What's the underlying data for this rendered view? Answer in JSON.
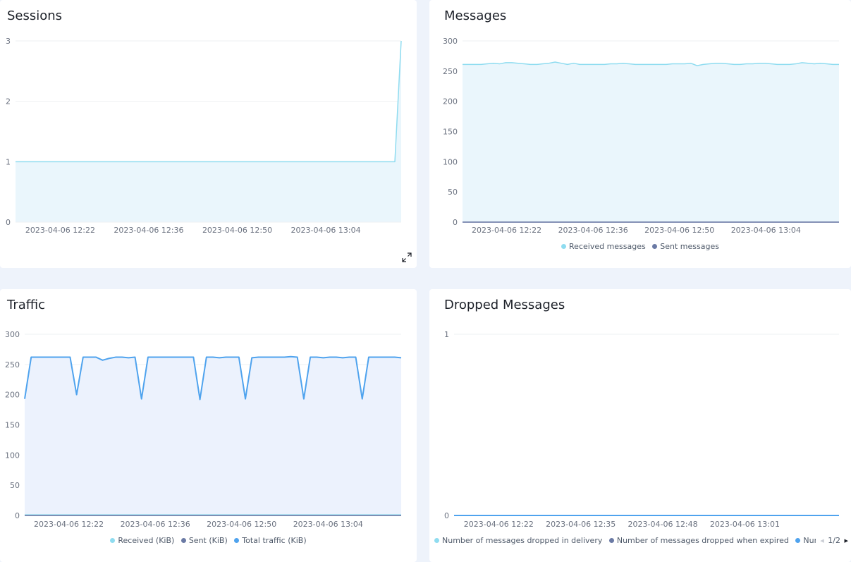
{
  "colors": {
    "received": "#8fdcf0",
    "sent": "#6b7aa5",
    "total": "#4fa3ee",
    "grid": "#eef0f3",
    "axis": "#6b7aa5"
  },
  "chart_data": [
    {
      "type": "area",
      "title": "Sessions",
      "x": [
        "2023-04-06 12:18",
        "2023-04-06 12:19",
        "2023-04-06 12:20",
        "2023-04-06 12:21",
        "2023-04-06 12:22",
        "2023-04-06 12:23",
        "2023-04-06 12:24",
        "2023-04-06 12:25",
        "2023-04-06 12:26",
        "2023-04-06 12:27",
        "2023-04-06 12:28",
        "2023-04-06 12:29",
        "2023-04-06 12:30",
        "2023-04-06 12:31",
        "2023-04-06 12:32",
        "2023-04-06 12:33",
        "2023-04-06 12:34",
        "2023-04-06 12:35",
        "2023-04-06 12:36",
        "2023-04-06 12:37",
        "2023-04-06 12:38",
        "2023-04-06 12:39",
        "2023-04-06 12:40",
        "2023-04-06 12:41",
        "2023-04-06 12:42",
        "2023-04-06 12:43",
        "2023-04-06 12:44",
        "2023-04-06 12:45",
        "2023-04-06 12:46",
        "2023-04-06 12:47",
        "2023-04-06 12:48",
        "2023-04-06 12:49",
        "2023-04-06 12:50",
        "2023-04-06 12:51",
        "2023-04-06 12:52",
        "2023-04-06 12:53",
        "2023-04-06 12:54",
        "2023-04-06 12:55",
        "2023-04-06 12:56",
        "2023-04-06 12:57",
        "2023-04-06 12:58",
        "2023-04-06 12:59",
        "2023-04-06 13:00",
        "2023-04-06 13:01",
        "2023-04-06 13:02",
        "2023-04-06 13:03",
        "2023-04-06 13:04",
        "2023-04-06 13:05",
        "2023-04-06 13:06",
        "2023-04-06 13:07",
        "2023-04-06 13:08",
        "2023-04-06 13:09",
        "2023-04-06 13:10",
        "2023-04-06 13:11",
        "2023-04-06 13:12",
        "2023-04-06 13:13",
        "2023-04-06 13:14",
        "2023-04-06 13:15",
        "2023-04-06 13:16",
        "2023-04-06 13:17",
        "2023-04-06 13:18",
        "2023-04-06 13:19"
      ],
      "xticks": [
        "2023-04-06 12:22",
        "2023-04-06 12:36",
        "2023-04-06 12:50",
        "2023-04-06 13:04"
      ],
      "ylim": [
        0,
        3
      ],
      "yticks": [
        0,
        1,
        2,
        3
      ],
      "grid": true,
      "legend": "none",
      "series": [
        {
          "color_key": "received",
          "values": [
            1,
            1,
            1,
            1,
            1,
            1,
            1,
            1,
            1,
            1,
            1,
            1,
            1,
            1,
            1,
            1,
            1,
            1,
            1,
            1,
            1,
            1,
            1,
            1,
            1,
            1,
            1,
            1,
            1,
            1,
            1,
            1,
            1,
            1,
            1,
            1,
            1,
            1,
            1,
            1,
            1,
            1,
            1,
            1,
            1,
            1,
            1,
            1,
            1,
            1,
            1,
            1,
            1,
            1,
            1,
            1,
            1,
            1,
            1,
            1,
            1,
            3
          ]
        }
      ]
    },
    {
      "type": "area",
      "title": "Messages",
      "x": [
        "2023-04-06 12:18",
        "2023-04-06 12:19",
        "2023-04-06 12:20",
        "2023-04-06 12:21",
        "2023-04-06 12:22",
        "2023-04-06 12:23",
        "2023-04-06 12:24",
        "2023-04-06 12:25",
        "2023-04-06 12:26",
        "2023-04-06 12:27",
        "2023-04-06 12:28",
        "2023-04-06 12:29",
        "2023-04-06 12:30",
        "2023-04-06 12:31",
        "2023-04-06 12:32",
        "2023-04-06 12:33",
        "2023-04-06 12:34",
        "2023-04-06 12:35",
        "2023-04-06 12:36",
        "2023-04-06 12:37",
        "2023-04-06 12:38",
        "2023-04-06 12:39",
        "2023-04-06 12:40",
        "2023-04-06 12:41",
        "2023-04-06 12:42",
        "2023-04-06 12:43",
        "2023-04-06 12:44",
        "2023-04-06 12:45",
        "2023-04-06 12:46",
        "2023-04-06 12:47",
        "2023-04-06 12:48",
        "2023-04-06 12:49",
        "2023-04-06 12:50",
        "2023-04-06 12:51",
        "2023-04-06 12:52",
        "2023-04-06 12:53",
        "2023-04-06 12:54",
        "2023-04-06 12:55",
        "2023-04-06 12:56",
        "2023-04-06 12:57",
        "2023-04-06 12:58",
        "2023-04-06 12:59",
        "2023-04-06 13:00",
        "2023-04-06 13:01",
        "2023-04-06 13:02",
        "2023-04-06 13:03",
        "2023-04-06 13:04",
        "2023-04-06 13:05",
        "2023-04-06 13:06",
        "2023-04-06 13:07",
        "2023-04-06 13:08",
        "2023-04-06 13:09",
        "2023-04-06 13:10",
        "2023-04-06 13:11",
        "2023-04-06 13:12",
        "2023-04-06 13:13",
        "2023-04-06 13:14",
        "2023-04-06 13:15",
        "2023-04-06 13:16",
        "2023-04-06 13:17",
        "2023-04-06 13:18",
        "2023-04-06 13:19"
      ],
      "xticks": [
        "2023-04-06 12:22",
        "2023-04-06 12:36",
        "2023-04-06 12:50",
        "2023-04-06 13:04"
      ],
      "ylim": [
        0,
        300
      ],
      "yticks": [
        0,
        50,
        100,
        150,
        200,
        250,
        300
      ],
      "grid": true,
      "legend": "bottom",
      "series": [
        {
          "name": "Received messages",
          "color_key": "received",
          "values": [
            261,
            261,
            261,
            261,
            262,
            263,
            262,
            264,
            264,
            263,
            262,
            261,
            261,
            262,
            263,
            265,
            263,
            261,
            263,
            261,
            261,
            261,
            261,
            261,
            262,
            262,
            263,
            262,
            261,
            261,
            261,
            261,
            261,
            261,
            262,
            262,
            262,
            263,
            259,
            261,
            262,
            263,
            263,
            262,
            261,
            261,
            262,
            262,
            263,
            263,
            262,
            261,
            261,
            261,
            262,
            264,
            263,
            262,
            263,
            262,
            261,
            261
          ]
        },
        {
          "name": "Sent messages",
          "color_key": "sent",
          "values": [
            0,
            0,
            0,
            0,
            0,
            0,
            0,
            0,
            0,
            0,
            0,
            0,
            0,
            0,
            0,
            0,
            0,
            0,
            0,
            0,
            0,
            0,
            0,
            0,
            0,
            0,
            0,
            0,
            0,
            0,
            0,
            0,
            0,
            0,
            0,
            0,
            0,
            0,
            0,
            0,
            0,
            0,
            0,
            0,
            0,
            0,
            0,
            0,
            0,
            0,
            0,
            0,
            0,
            0,
            0,
            0,
            0,
            0,
            0,
            0,
            0,
            0
          ]
        }
      ]
    },
    {
      "type": "area",
      "title": "Traffic",
      "x": [
        "2023-04-06 12:18",
        "2023-04-06 12:19",
        "2023-04-06 12:20",
        "2023-04-06 12:21",
        "2023-04-06 12:22",
        "2023-04-06 12:23",
        "2023-04-06 12:24",
        "2023-04-06 12:25",
        "2023-04-06 12:26",
        "2023-04-06 12:27",
        "2023-04-06 12:28",
        "2023-04-06 12:29",
        "2023-04-06 12:30",
        "2023-04-06 12:31",
        "2023-04-06 12:32",
        "2023-04-06 12:33",
        "2023-04-06 12:34",
        "2023-04-06 12:35",
        "2023-04-06 12:36",
        "2023-04-06 12:37",
        "2023-04-06 12:38",
        "2023-04-06 12:39",
        "2023-04-06 12:40",
        "2023-04-06 12:41",
        "2023-04-06 12:42",
        "2023-04-06 12:43",
        "2023-04-06 12:44",
        "2023-04-06 12:45",
        "2023-04-06 12:46",
        "2023-04-06 12:47",
        "2023-04-06 12:48",
        "2023-04-06 12:49",
        "2023-04-06 12:50",
        "2023-04-06 12:51",
        "2023-04-06 12:52",
        "2023-04-06 12:53",
        "2023-04-06 12:54",
        "2023-04-06 12:55",
        "2023-04-06 12:56",
        "2023-04-06 12:57",
        "2023-04-06 12:58",
        "2023-04-06 12:59",
        "2023-04-06 13:00",
        "2023-04-06 13:01",
        "2023-04-06 13:02",
        "2023-04-06 13:03",
        "2023-04-06 13:04",
        "2023-04-06 13:05",
        "2023-04-06 13:06",
        "2023-04-06 13:07",
        "2023-04-06 13:08",
        "2023-04-06 13:09",
        "2023-04-06 13:10",
        "2023-04-06 13:11",
        "2023-04-06 13:12",
        "2023-04-06 13:13",
        "2023-04-06 13:14",
        "2023-04-06 13:15",
        "2023-04-06 13:16",
        "2023-04-06 13:17",
        "2023-04-06 13:18",
        "2023-04-06 13:19"
      ],
      "xticks": [
        "2023-04-06 12:22",
        "2023-04-06 12:36",
        "2023-04-06 12:50",
        "2023-04-06 13:04"
      ],
      "ylim": [
        0,
        300
      ],
      "yticks": [
        0,
        50,
        100,
        150,
        200,
        250,
        300
      ],
      "grid": true,
      "legend": "bottom",
      "series": [
        {
          "name": "Received (KiB)",
          "color_key": "received",
          "values": [
            1,
            1,
            1,
            1,
            1,
            1,
            1,
            1,
            1,
            1,
            1,
            1,
            1,
            1,
            1,
            1,
            1,
            1,
            1,
            1,
            1,
            1,
            1,
            1,
            1,
            1,
            1,
            1,
            1,
            1,
            1,
            1,
            1,
            1,
            1,
            1,
            1,
            1,
            1,
            1,
            1,
            1,
            1,
            1,
            1,
            1,
            1,
            1,
            1,
            1,
            1,
            1,
            1,
            1,
            1,
            1,
            1,
            1,
            1,
            1,
            1,
            1
          ]
        },
        {
          "name": "Sent (KiB)",
          "color_key": "sent",
          "values": [
            0,
            0,
            0,
            0,
            0,
            0,
            0,
            0,
            0,
            0,
            0,
            0,
            0,
            0,
            0,
            0,
            0,
            0,
            0,
            0,
            0,
            0,
            0,
            0,
            0,
            0,
            0,
            0,
            0,
            0,
            0,
            0,
            0,
            0,
            0,
            0,
            0,
            0,
            0,
            0,
            0,
            0,
            0,
            0,
            0,
            0,
            0,
            0,
            0,
            0,
            0,
            0,
            0,
            0,
            0,
            0,
            0,
            0,
            0,
            0,
            0,
            0
          ]
        },
        {
          "name": "Total traffic (KiB)",
          "color_key": "total",
          "values": [
            193,
            262,
            262,
            262,
            262,
            262,
            262,
            262,
            200,
            262,
            262,
            262,
            257,
            260,
            262,
            262,
            261,
            262,
            193,
            262,
            262,
            262,
            262,
            262,
            262,
            262,
            262,
            192,
            262,
            262,
            261,
            262,
            262,
            262,
            193,
            261,
            262,
            262,
            262,
            262,
            262,
            263,
            262,
            193,
            262,
            262,
            261,
            262,
            262,
            261,
            262,
            262,
            193,
            262,
            262,
            262,
            262,
            262,
            261
          ]
        }
      ]
    },
    {
      "type": "area",
      "title": "Dropped Messages",
      "x": [
        "2023-04-06 12:18",
        "2023-04-06 12:19",
        "2023-04-06 12:20",
        "2023-04-06 12:21",
        "2023-04-06 12:22",
        "2023-04-06 12:23",
        "2023-04-06 12:24",
        "2023-04-06 12:25",
        "2023-04-06 12:26",
        "2023-04-06 12:27",
        "2023-04-06 12:28",
        "2023-04-06 12:29",
        "2023-04-06 12:30",
        "2023-04-06 12:31",
        "2023-04-06 12:32",
        "2023-04-06 12:33",
        "2023-04-06 12:34",
        "2023-04-06 12:35",
        "2023-04-06 12:36",
        "2023-04-06 12:37",
        "2023-04-06 12:38",
        "2023-04-06 12:39",
        "2023-04-06 12:40",
        "2023-04-06 12:41",
        "2023-04-06 12:42",
        "2023-04-06 12:43",
        "2023-04-06 12:44",
        "2023-04-06 12:45",
        "2023-04-06 12:46",
        "2023-04-06 12:47",
        "2023-04-06 12:48",
        "2023-04-06 12:49",
        "2023-04-06 12:50",
        "2023-04-06 12:51",
        "2023-04-06 12:52",
        "2023-04-06 12:53",
        "2023-04-06 12:54",
        "2023-04-06 12:55",
        "2023-04-06 12:56",
        "2023-04-06 12:57",
        "2023-04-06 12:58",
        "2023-04-06 12:59",
        "2023-04-06 13:00",
        "2023-04-06 13:01",
        "2023-04-06 13:02",
        "2023-04-06 13:03",
        "2023-04-06 13:04",
        "2023-04-06 13:05",
        "2023-04-06 13:06",
        "2023-04-06 13:07",
        "2023-04-06 13:08",
        "2023-04-06 13:09",
        "2023-04-06 13:10",
        "2023-04-06 13:11",
        "2023-04-06 13:12",
        "2023-04-06 13:13",
        "2023-04-06 13:14",
        "2023-04-06 13:15",
        "2023-04-06 13:16",
        "2023-04-06 13:17",
        "2023-04-06 13:18",
        "2023-04-06 13:19"
      ],
      "xticks": [
        "2023-04-06 12:22",
        "2023-04-06 12:35",
        "2023-04-06 12:48",
        "2023-04-06 13:01"
      ],
      "ylim": [
        0,
        1
      ],
      "yticks": [
        0,
        1
      ],
      "grid": true,
      "legend": "bottom",
      "series": [
        {
          "name": "Number of messages dropped in delivery",
          "color_key": "received",
          "values": [
            0,
            0,
            0,
            0,
            0,
            0,
            0,
            0,
            0,
            0,
            0,
            0,
            0,
            0,
            0,
            0,
            0,
            0,
            0,
            0,
            0,
            0,
            0,
            0,
            0,
            0,
            0,
            0,
            0,
            0,
            0,
            0,
            0,
            0,
            0,
            0,
            0,
            0,
            0,
            0,
            0,
            0,
            0,
            0,
            0,
            0,
            0,
            0,
            0,
            0,
            0,
            0,
            0,
            0,
            0,
            0,
            0,
            0,
            0,
            0,
            0,
            0
          ]
        },
        {
          "name": "Number of messages dropped when expired",
          "color_key": "sent",
          "values": [
            0,
            0,
            0,
            0,
            0,
            0,
            0,
            0,
            0,
            0,
            0,
            0,
            0,
            0,
            0,
            0,
            0,
            0,
            0,
            0,
            0,
            0,
            0,
            0,
            0,
            0,
            0,
            0,
            0,
            0,
            0,
            0,
            0,
            0,
            0,
            0,
            0,
            0,
            0,
            0,
            0,
            0,
            0,
            0,
            0,
            0,
            0,
            0,
            0,
            0,
            0,
            0,
            0,
            0,
            0,
            0,
            0,
            0,
            0,
            0,
            0,
            0
          ]
        },
        {
          "name": "Number o",
          "color_key": "total",
          "values": [
            0,
            0,
            0,
            0,
            0,
            0,
            0,
            0,
            0,
            0,
            0,
            0,
            0,
            0,
            0,
            0,
            0,
            0,
            0,
            0,
            0,
            0,
            0,
            0,
            0,
            0,
            0,
            0,
            0,
            0,
            0,
            0,
            0,
            0,
            0,
            0,
            0,
            0,
            0,
            0,
            0,
            0,
            0,
            0,
            0,
            0,
            0,
            0,
            0,
            0,
            0,
            0,
            0,
            0,
            0,
            0,
            0,
            0,
            0,
            0,
            0,
            0
          ]
        }
      ]
    }
  ],
  "pager": {
    "label": "1/2",
    "prev_icon": "caret-left-icon",
    "next_icon": "caret-right-icon"
  },
  "expand_icon": "expand-icon"
}
